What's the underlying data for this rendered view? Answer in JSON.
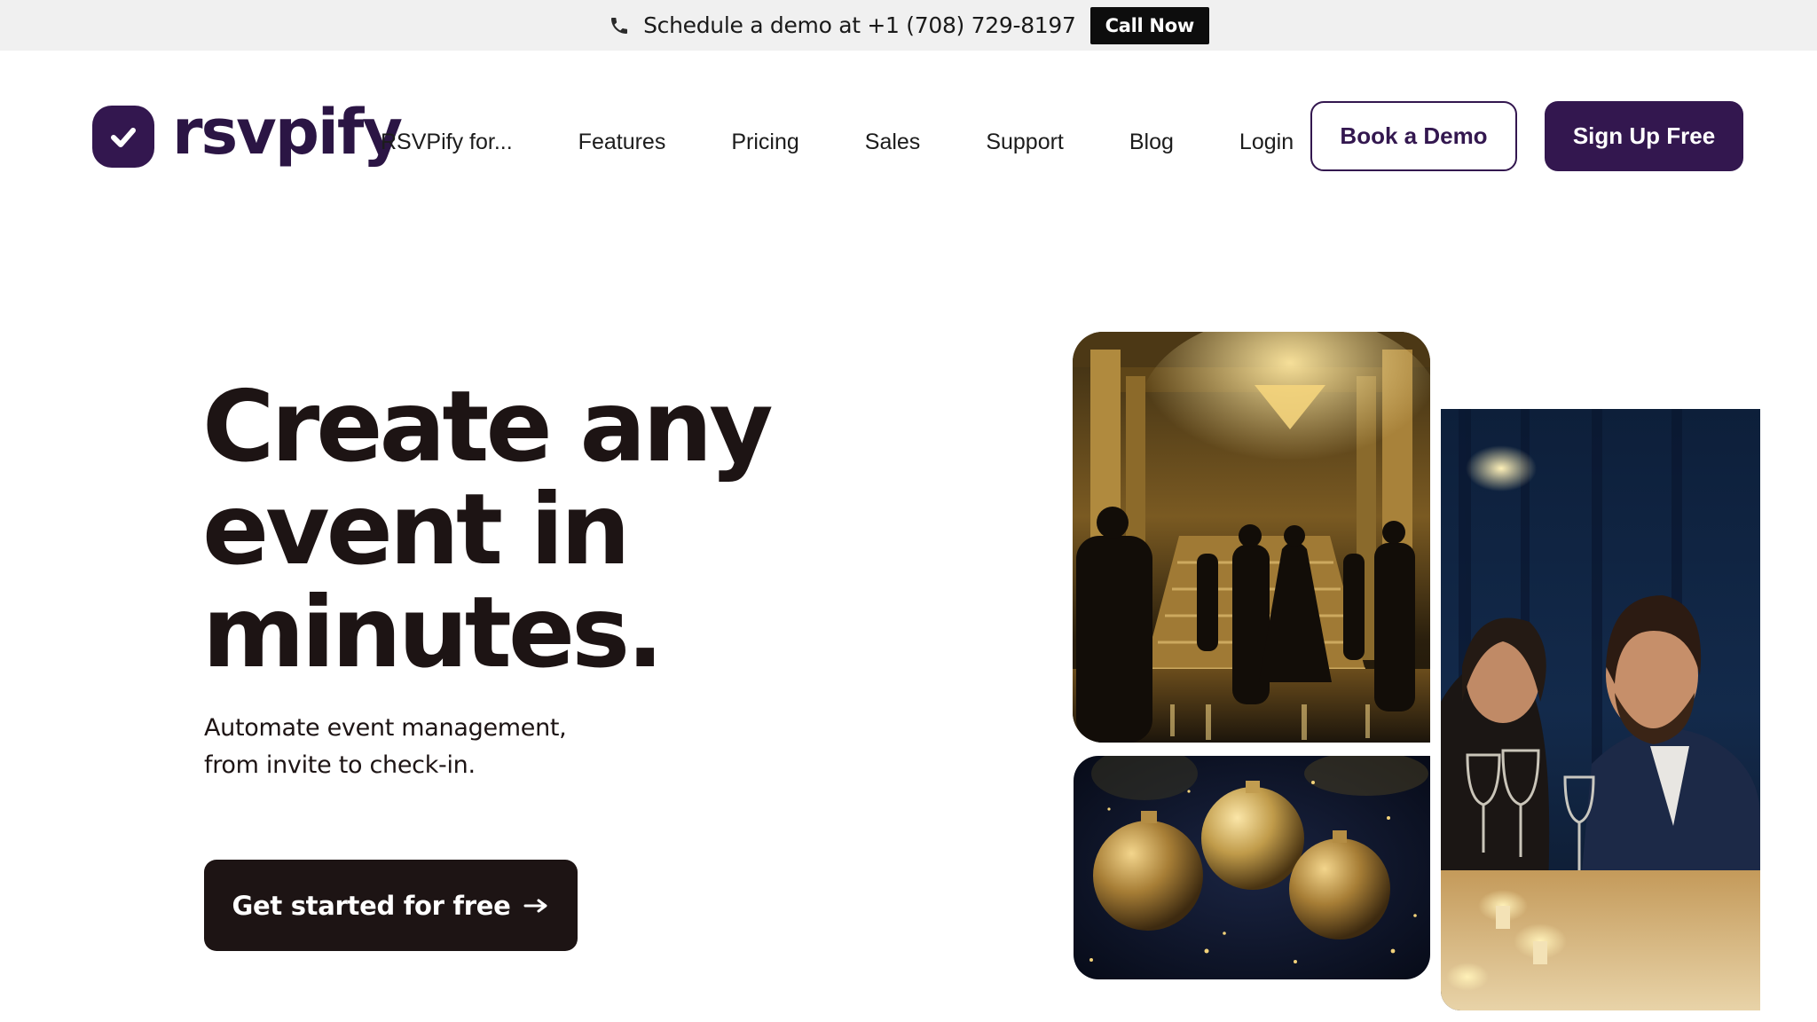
{
  "topbar": {
    "icon": "phone-icon",
    "text": "Schedule a demo at +1 (708) 729-8197",
    "cta_label": "Call Now"
  },
  "header": {
    "logo_text": "rsvpify",
    "logo_icon": "checkmark-icon",
    "nav": [
      {
        "label": "RSVPify for..."
      },
      {
        "label": "Features"
      },
      {
        "label": "Pricing"
      },
      {
        "label": "Sales"
      },
      {
        "label": "Support"
      },
      {
        "label": "Blog"
      },
      {
        "label": "Login"
      }
    ],
    "book_demo_label": "Book a Demo",
    "signup_label": "Sign Up Free"
  },
  "hero": {
    "title_lines": [
      "Create any",
      "event in",
      "minutes."
    ],
    "subtitle_lines": [
      "Automate event management,",
      "from invite to check-in."
    ],
    "cta_label": "Get started for free",
    "cta_icon": "arrow-right-icon"
  },
  "colors": {
    "brand_purple": "#33174f",
    "dark": "#1d1414",
    "topbar_bg": "#f0f0f0"
  }
}
